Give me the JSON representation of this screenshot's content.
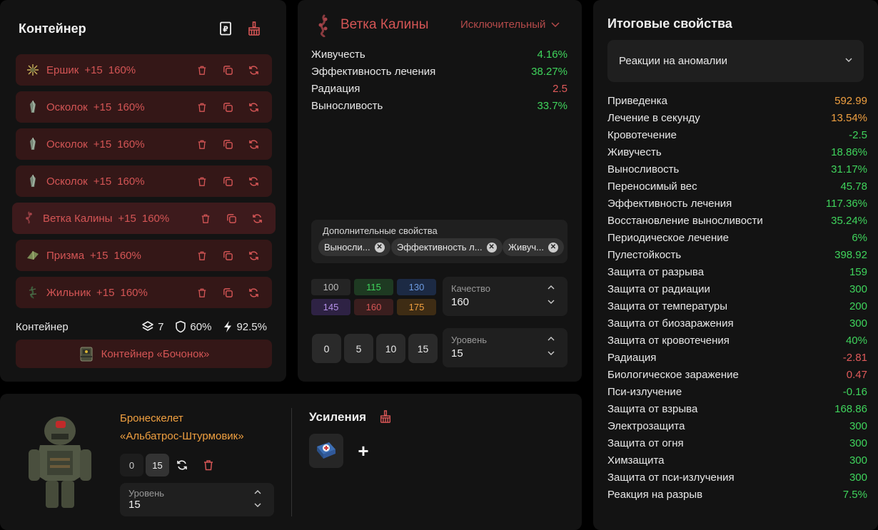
{
  "container": {
    "title": "Контейнер",
    "artifacts": [
      {
        "name": "Ершик",
        "level": "+15",
        "percent": "160%"
      },
      {
        "name": "Осколок",
        "level": "+15",
        "percent": "160%"
      },
      {
        "name": "Осколок",
        "level": "+15",
        "percent": "160%"
      },
      {
        "name": "Осколок",
        "level": "+15",
        "percent": "160%"
      },
      {
        "name": "Ветка Калины",
        "level": "+15",
        "percent": "160%"
      },
      {
        "name": "Призма",
        "level": "+15",
        "percent": "160%"
      },
      {
        "name": "Жильник",
        "level": "+15",
        "percent": "160%"
      }
    ],
    "footer_label": "Контейнер",
    "slots": "7",
    "protection": "60%",
    "efficiency": "92.5%",
    "button_label": "Контейнер «Бочонок»"
  },
  "artifact": {
    "name": "Ветка Калины",
    "rarity": "Исключительный",
    "props": [
      {
        "name": "Живучесть",
        "value": "4.16%",
        "color": "green"
      },
      {
        "name": "Эффективность лечения",
        "value": "38.27%",
        "color": "green"
      },
      {
        "name": "Радиация",
        "value": "2.5",
        "color": "red"
      },
      {
        "name": "Выносливость",
        "value": "33.7%",
        "color": "green"
      }
    ],
    "extra_label": "Дополнительные свойства",
    "extra_chips": [
      "Выносли...",
      "Эффективность л...",
      "Живуч..."
    ],
    "quality_buttons": [
      "100",
      "115",
      "130",
      "145",
      "160",
      "175"
    ],
    "quality_label": "Качество",
    "quality_value": "160",
    "level_buttons": [
      "0",
      "5",
      "10",
      "15"
    ],
    "level_label": "Уровень",
    "level_value": "15"
  },
  "armor": {
    "name_line1": "Бронескелет",
    "name_line2": "«Альбатрос-Штурмовик»",
    "btn_min": "0",
    "btn_max": "15",
    "level_label": "Уровень",
    "level_value": "15",
    "boosts_title": "Усиления",
    "add_symbol": "+"
  },
  "summary": {
    "title": "Итоговые свойства",
    "select_value": "Реакции на аномалии",
    "rows": [
      {
        "name": "Приведенка",
        "value": "592.99",
        "color": "orange"
      },
      {
        "name": "Лечение в секунду",
        "value": "13.54%",
        "color": "orange"
      },
      {
        "name": "Кровотечение",
        "value": "-2.5",
        "color": "green"
      },
      {
        "name": "Живучесть",
        "value": "18.86%",
        "color": "green"
      },
      {
        "name": "Выносливость",
        "value": "31.17%",
        "color": "green"
      },
      {
        "name": "Переносимый вес",
        "value": "45.78",
        "color": "green"
      },
      {
        "name": "Эффективность лечения",
        "value": "117.36%",
        "color": "green"
      },
      {
        "name": "Восстановление выносливости",
        "value": "35.24%",
        "color": "green"
      },
      {
        "name": "Периодическое лечение",
        "value": "6%",
        "color": "green"
      },
      {
        "name": "Пулестойкость",
        "value": "398.92",
        "color": "green"
      },
      {
        "name": "Защита от разрыва",
        "value": "159",
        "color": "green"
      },
      {
        "name": "Защита от радиации",
        "value": "300",
        "color": "green"
      },
      {
        "name": "Защита от температуры",
        "value": "200",
        "color": "green"
      },
      {
        "name": "Защита от биозаражения",
        "value": "300",
        "color": "green"
      },
      {
        "name": "Защита от кровотечения",
        "value": "40%",
        "color": "green"
      },
      {
        "name": "Радиация",
        "value": "-2.81",
        "color": "red"
      },
      {
        "name": "Биологическое заражение",
        "value": "0.47",
        "color": "red"
      },
      {
        "name": "Пси-излучение",
        "value": "-0.16",
        "color": "green"
      },
      {
        "name": "Защита от взрыва",
        "value": "168.86",
        "color": "green"
      },
      {
        "name": "Электрозащита",
        "value": "300",
        "color": "green"
      },
      {
        "name": "Защита от огня",
        "value": "300",
        "color": "green"
      },
      {
        "name": "Химзащита",
        "value": "300",
        "color": "green"
      },
      {
        "name": "Защита от пси-излучения",
        "value": "300",
        "color": "green"
      },
      {
        "name": "Реакция на разрыв",
        "value": "7.5%",
        "color": "green"
      }
    ]
  },
  "colors": {
    "accent_red": "#d45555",
    "positive": "#3fd45c",
    "highlight": "#f0a040",
    "panel_bg": "#131313",
    "row_bg": "#341717"
  }
}
